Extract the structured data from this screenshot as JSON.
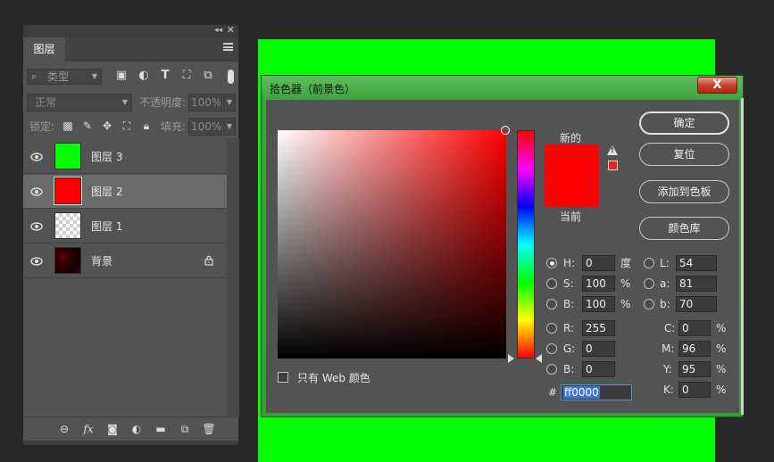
{
  "canvas": {
    "color": "#00ff00"
  },
  "layers_panel": {
    "tab_label": "图层",
    "filter": {
      "label": "类型"
    },
    "blend_mode": "正常",
    "opacity_label": "不透明度:",
    "opacity_value": "100%",
    "lock_label": "锁定:",
    "fill_label": "填充:",
    "fill_value": "100%",
    "layers": [
      {
        "name": "图层 3",
        "thumb": "green",
        "selected": false,
        "locked": false
      },
      {
        "name": "图层 2",
        "thumb": "red",
        "selected": true,
        "locked": false
      },
      {
        "name": "图层 1",
        "thumb": "transparent",
        "selected": false,
        "locked": false
      },
      {
        "name": "背景",
        "thumb": "dark-red",
        "selected": false,
        "locked": true
      }
    ],
    "footer_icons": [
      "link-icon",
      "fx-icon",
      "mask-icon",
      "adjustment-icon",
      "folder-icon",
      "new-layer-icon",
      "trash-icon"
    ],
    "fx_label": "fx"
  },
  "color_picker": {
    "title": "拾色器（前景色）",
    "close_label": "X",
    "new_label": "新的",
    "current_label": "当前",
    "new_color": "#ff0000",
    "current_color": "#ff0000",
    "buttons": {
      "ok": "确定",
      "reset": "复位",
      "add_swatch": "添加到色板",
      "libraries": "颜色库"
    },
    "fields": {
      "H": {
        "label": "H:",
        "value": "0",
        "unit": "度"
      },
      "S": {
        "label": "S:",
        "value": "100",
        "unit": "%"
      },
      "Bv": {
        "label": "B:",
        "value": "100",
        "unit": "%"
      },
      "R": {
        "label": "R:",
        "value": "255"
      },
      "G": {
        "label": "G:",
        "value": "0"
      },
      "Bb": {
        "label": "B:",
        "value": "0"
      },
      "L": {
        "label": "L:",
        "value": "54"
      },
      "a": {
        "label": "a:",
        "value": "81"
      },
      "b": {
        "label": "b:",
        "value": "70"
      },
      "C": {
        "label": "C:",
        "value": "0",
        "unit": "%"
      },
      "M": {
        "label": "M:",
        "value": "96",
        "unit": "%"
      },
      "Y": {
        "label": "Y:",
        "value": "95",
        "unit": "%"
      },
      "K": {
        "label": "K:",
        "value": "0",
        "unit": "%"
      }
    },
    "selected_mode": "H",
    "hex_label": "#",
    "hex_value": "ff0000",
    "web_only_label": "只有 Web 颜色",
    "web_only_checked": false
  }
}
